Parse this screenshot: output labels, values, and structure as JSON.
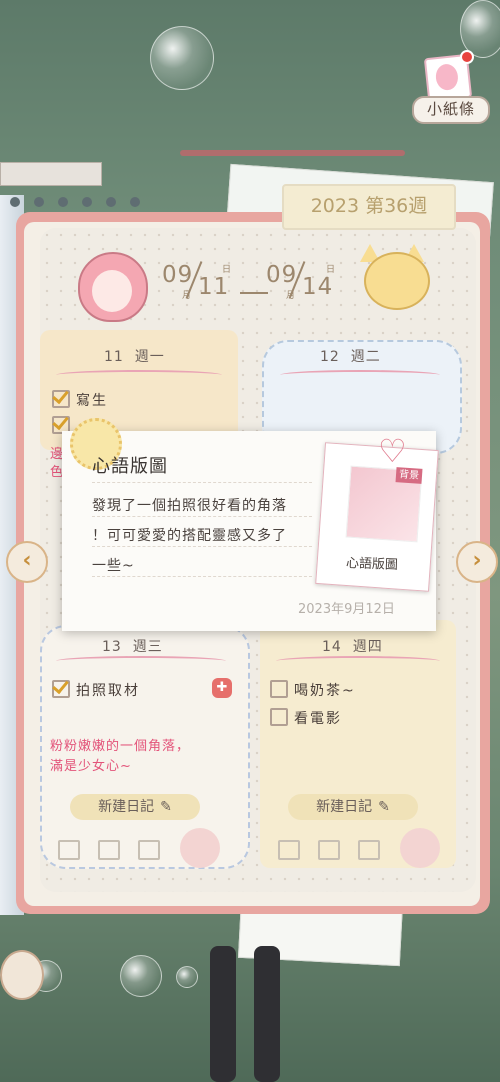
{
  "note_button": {
    "label": "小紙條",
    "icon": "note-icon"
  },
  "planner": {
    "week_label": "2023 第36週",
    "start_date": {
      "month": "09",
      "day": "11",
      "day_unit": "日",
      "month_unit": "月"
    },
    "end_date": {
      "month": "09",
      "day": "14",
      "day_unit": "日",
      "month_unit": "月"
    }
  },
  "days": [
    {
      "num": "11",
      "weekday": "週一",
      "tasks": [
        {
          "text": "寫生",
          "checked": true
        },
        {
          "text": "",
          "checked": true
        }
      ],
      "memo_lines": [
        "邊",
        "色"
      ]
    },
    {
      "num": "12",
      "weekday": "週二",
      "tasks": [],
      "memo_lines": []
    },
    {
      "num": "13",
      "weekday": "週三",
      "tasks": [
        {
          "text": "拍照取材",
          "checked": true
        }
      ],
      "memo_lines": [
        "粉粉嫩嫩的一個角落，",
        "滿是少女心~"
      ],
      "new_entry": "新建日記"
    },
    {
      "num": "14",
      "weekday": "週四",
      "tasks": [
        {
          "text": "喝奶茶~",
          "checked": false
        },
        {
          "text": "看電影",
          "checked": false
        }
      ],
      "memo_lines": [],
      "new_entry": "新建日記"
    }
  ],
  "popup": {
    "title": "心語版圖",
    "lines": [
      "發現了一個拍照很好看的角落",
      "！可可愛愛的搭配靈感又多了",
      "一些~"
    ],
    "date": "2023年9月12日",
    "photo_tag": "背景",
    "photo_label": "心語版圖"
  },
  "nav": {
    "prev": "‹",
    "next": "›"
  }
}
